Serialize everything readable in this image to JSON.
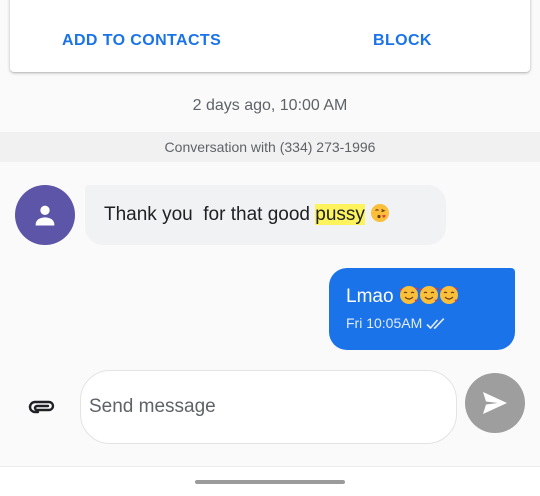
{
  "header": {
    "add_to_contacts_label": "ADD TO CONTACTS",
    "block_label": "BLOCK"
  },
  "thread": {
    "timestamp": "2 days ago, 10:00 AM",
    "conversation_label": "Conversation with (334) 273-1996"
  },
  "messages": [
    {
      "direction": "incoming",
      "text_before": "Thank you  for that good ",
      "highlighted_word": "pussy",
      "emoji": "kissing-heart-emoji"
    },
    {
      "direction": "outgoing",
      "text": "Lmao ",
      "emojis": [
        "smiling-hearts-emoji",
        "smiling-hearts-emoji",
        "smiling-hearts-emoji"
      ],
      "time": "Fri 10:05AM",
      "status_icon": "double-check-icon"
    }
  ],
  "compose": {
    "placeholder": "Send message",
    "value": ""
  },
  "colors": {
    "accent": "#1a73e8",
    "avatar": "#5c55a8",
    "incoming_bubble": "#f1f2f4",
    "highlight": "#fdf35c",
    "send_button": "#9e9e9e"
  }
}
